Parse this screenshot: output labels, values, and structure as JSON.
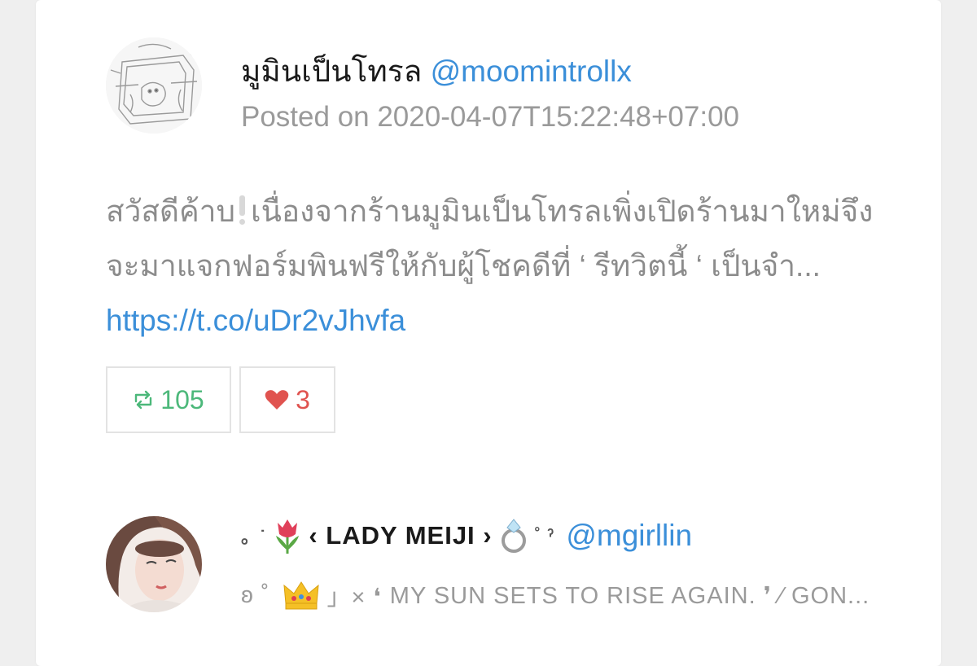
{
  "tweet_1": {
    "display_name": "มูมินเป็นโทรล",
    "handle": "@moomintrollx",
    "posted": "Posted on 2020-04-07T15:22:48+07:00",
    "text_part1": "สวัสดีค้าบ",
    "text_part2": "เนื่องจากร้านมูมินเป็นโทรลเพิ่งเปิดร้านมาใหม่จึงจะมาแจกฟอร์มพินฟรีให้กับผู้โชคดีที่ ‘ รีทวิตนี้ ‘ เป็นจำ...",
    "link": "https://t.co/uDr2vJhvfa",
    "retweets": "105",
    "likes": "3"
  },
  "user_2": {
    "name_prefix": "。˙",
    "name_text": "‹ LADY MEIJI ›",
    "name_suffix": "˚ ˀ",
    "handle": "@mgirllin",
    "bio_prefix": "ʚ ˚",
    "bio_mid": "」× ❛",
    "bio_text": "MY SUN SETS TO RISE AGAIN. ❜ ⁄ GON..."
  },
  "icons": {
    "exclamation": "white-exclamation-icon",
    "retweet": "retweet-icon",
    "like": "heart-icon",
    "tulip": "tulip-emoji",
    "ring": "ring-emoji",
    "crown": "crown-emoji"
  },
  "colors": {
    "link": "#3b8fd9",
    "retweet": "#4cb87a",
    "like": "#e0534f",
    "muted": "#9a9a9a"
  }
}
